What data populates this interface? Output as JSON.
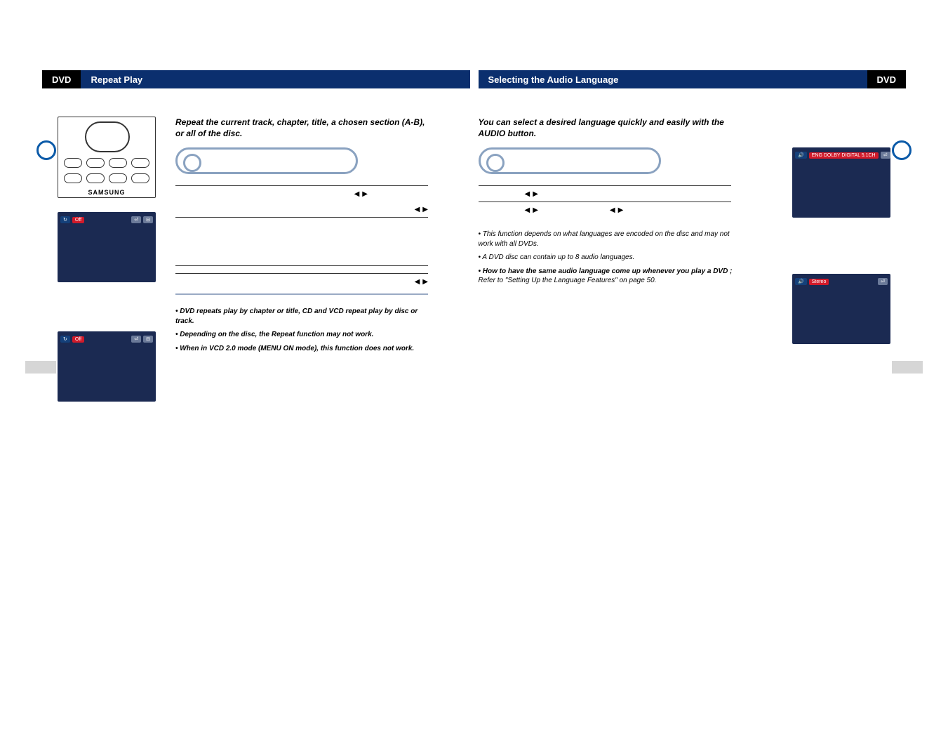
{
  "header": {
    "left": {
      "tag": "DVD",
      "title": "Repeat Play"
    },
    "right": {
      "tag": "DVD",
      "title": "Selecting the Audio Language"
    }
  },
  "remote": {
    "brand": "SAMSUNG"
  },
  "left_page": {
    "lead": "Repeat the current track, chapter, title, a chosen section (A-B), or all of the disc.",
    "notes": [
      "• DVD repeats play by chapter or title, CD and VCD repeat play by disc or track.",
      "• Depending on the disc, the Repeat function may not work.",
      "• When in VCD 2.0 mode (MENU ON mode), this function does not work."
    ]
  },
  "right_page": {
    "lead": "You can select a desired language quickly and easily with the AUDIO button.",
    "notes": [
      {
        "kind": "italic",
        "text": "• This function depends on what languages are encoded on the disc and may not work with all DVDs."
      },
      {
        "kind": "italic",
        "text": "• A DVD disc can contain up to 8 audio languages."
      },
      {
        "kind": "bold",
        "text": "• How to have the same audio language come up whenever you play a DVD ;"
      },
      {
        "kind": "italic",
        "text": "  Refer to \"Setting Up the Language Features\" on page 50."
      }
    ],
    "screen_dvd_label": "ENG  DOLBY DIGITAL  5.1CH",
    "screen_vcd_label": "Stereo"
  },
  "osd": {
    "off_label": "Off"
  }
}
